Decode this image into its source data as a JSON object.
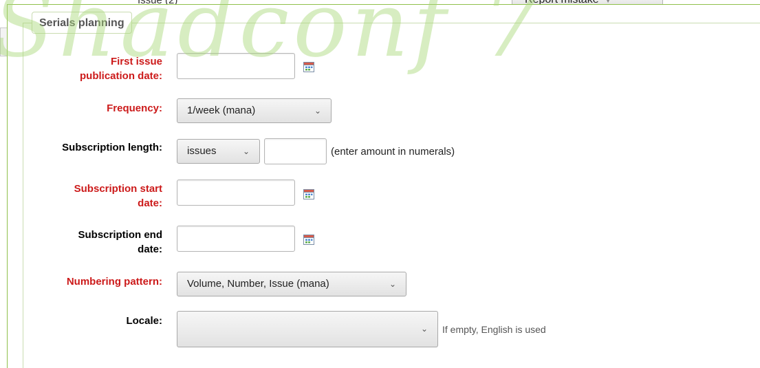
{
  "background": {
    "issue_text": "Issue (2)",
    "report_button_label": "Report mistake"
  },
  "watermark": {
    "text": "Shadconf 7"
  },
  "fieldset": {
    "legend": "Serials planning"
  },
  "form": {
    "first_issue": {
      "label_line1": "First issue",
      "label_line2": "publication date:",
      "value": "",
      "icon": "calendar-icon"
    },
    "frequency": {
      "label": "Frequency:",
      "selected": "1/week (mana)"
    },
    "subscription_length": {
      "label": "Subscription length:",
      "unit_selected": "issues",
      "amount_value": "",
      "hint": "(enter amount in numerals)"
    },
    "subscription_start": {
      "label_line1": "Subscription start",
      "label_line2": "date:",
      "value": "",
      "icon": "calendar-icon"
    },
    "subscription_end": {
      "label_line1": "Subscription end",
      "label_line2": "date:",
      "value": "",
      "icon": "calendar-icon"
    },
    "numbering_pattern": {
      "label": "Numbering pattern:",
      "selected": "Volume, Number, Issue (mana)"
    },
    "locale": {
      "label": "Locale:",
      "selected": "",
      "hint": "If empty, English is used"
    }
  },
  "colors": {
    "required_label": "#cc1a1a",
    "panel_border": "#8fc04a",
    "watermark": "#a8d878"
  }
}
